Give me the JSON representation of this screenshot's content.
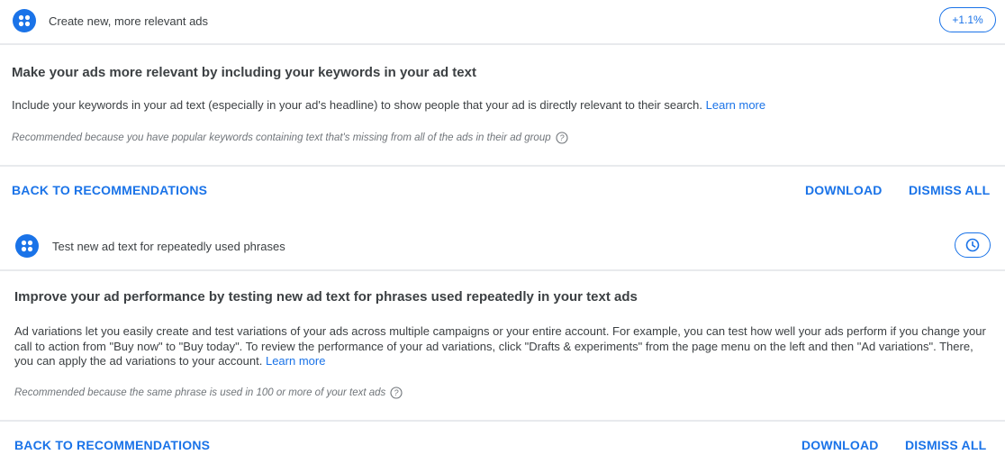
{
  "card1": {
    "header": "Create new, more relevant ads",
    "badge": "+1.1%",
    "title": "Make your ads more relevant by including your keywords in your ad text",
    "description": "Include your keywords in your ad text (especially in your ad's headline) to show people that your ad is directly relevant to their search.",
    "learn_more": "Learn more",
    "reason": "Recommended because you have popular keywords containing text that's missing from all of the ads in their ad group",
    "back": "BACK TO RECOMMENDATIONS",
    "download": "DOWNLOAD",
    "dismiss": "DISMISS ALL"
  },
  "card2": {
    "header": "Test new ad text for repeatedly used phrases",
    "badge_icon": "clock-icon",
    "title": "Improve your ad performance by testing new ad text for phrases used repeatedly in your text ads",
    "description": "Ad variations let you easily create and test variations of your ads across multiple campaigns or your entire account. For example, you can test how well your ads perform if you change your call to action from \"Buy now\" to \"Buy today\". To review the performance of your ad variations, click \"Drafts & experiments\" from the page menu on the left and then \"Ad variations\". There, you can apply the ad variations to your account.",
    "learn_more": "Learn more",
    "reason": "Recommended because the same phrase is used in 100 or more of your text ads",
    "back": "BACK TO RECOMMENDATIONS",
    "download": "DOWNLOAD",
    "dismiss": "DISMISS ALL"
  },
  "colors": {
    "accent": "#1a73e8",
    "text": "#3c4043",
    "muted": "#70757a",
    "divider": "#e8eaed"
  }
}
